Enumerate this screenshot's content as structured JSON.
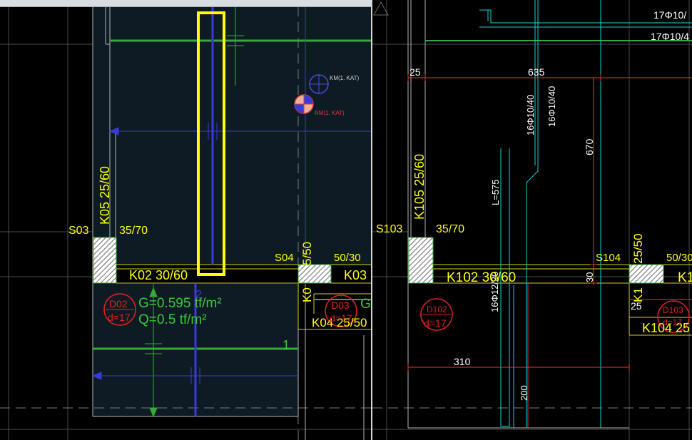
{
  "left": {
    "column_labels": {
      "s03": "S03",
      "s03_size": "35/70",
      "s04": "S04",
      "s04_size": "50/30"
    },
    "beam_labels": {
      "k05": "K05 25/60",
      "k02": "K02 30/60",
      "k03": "K03",
      "k0x": "K0",
      "k0x_size": "5/50",
      "k04": "K04 25/50"
    },
    "slab_d02": {
      "name": "D02",
      "thickness": "d=17",
      "load_g": "G=0.595 tf/m²",
      "load_q": "Q=0.5 tf/m²"
    },
    "slab_d03": {
      "name": "D03",
      "thickness": "d=17",
      "load_g_partial": "G"
    },
    "markers": {
      "km": "KM(1. KAT)",
      "rm": "RM(1. KAT)"
    },
    "axis_numbers": {
      "axis_1": "1",
      "axis_2": "2"
    }
  },
  "right": {
    "rebar": {
      "top1": "17Φ10/",
      "top2": "17Φ10/4",
      "stirrup1": "16Φ10/40",
      "stirrup2": "16Φ10/40",
      "bottom": "16Φ12/20",
      "length": "L=575"
    },
    "dims": {
      "d25_top": "25",
      "d635": "635",
      "d670": "670",
      "d30": "30",
      "d310": "310",
      "d200": "200",
      "d25_side": "25"
    },
    "column_labels": {
      "s103": "S103",
      "s103_size": "35/70",
      "s104": "S104",
      "s104_size": "50/30"
    },
    "beam_labels": {
      "k105": "K105 25/60",
      "k102": "K102 30/60",
      "k1x": "K1",
      "k1x_size": "25/50",
      "k104": "K104 25",
      "k10x": "K1"
    },
    "slab_d102": {
      "name": "D102",
      "thickness": "d=17"
    },
    "slab_d103": {
      "name": "D103",
      "thickness": "d=17"
    }
  },
  "colors": {
    "background": "#000000",
    "selection": "#ffff00",
    "slab_fill": "#0e1b24",
    "dimension": "#ff3030",
    "rebar": "#00d8d8",
    "beam": "#37a83b",
    "axis": "#3a3ad6"
  }
}
